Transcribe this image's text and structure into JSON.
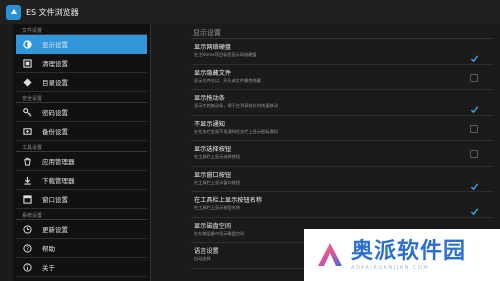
{
  "app": {
    "title": "ES 文件浏览器"
  },
  "sidebar": {
    "sections": [
      {
        "header": "文件设置",
        "items": [
          {
            "label": "显示设置",
            "icon": "display-icon",
            "active": true
          },
          {
            "label": "清理设置",
            "icon": "clean-icon",
            "active": false
          },
          {
            "label": "目录设置",
            "icon": "directory-icon",
            "active": false
          }
        ]
      },
      {
        "header": "安全设置",
        "items": [
          {
            "label": "密码设置",
            "icon": "key-icon",
            "active": false
          },
          {
            "label": "备份设置",
            "icon": "backup-icon",
            "active": false
          }
        ]
      },
      {
        "header": "工具设置",
        "items": [
          {
            "label": "应用管理器",
            "icon": "app-manager-icon",
            "active": false
          },
          {
            "label": "下载管理器",
            "icon": "download-icon",
            "active": false
          },
          {
            "label": "窗口设置",
            "icon": "window-icon",
            "active": false
          }
        ]
      },
      {
        "header": "系统设置",
        "items": [
          {
            "label": "更新设置",
            "icon": "update-icon",
            "active": false
          },
          {
            "label": "帮助",
            "icon": "help-icon",
            "active": false
          },
          {
            "label": "关于",
            "icon": "about-icon",
            "active": false
          }
        ]
      }
    ]
  },
  "content": {
    "header": "显示设置",
    "rows": [
      {
        "title": "显示网络硬盘",
        "subtitle": "在主Home项目标签显示网络硬盘",
        "checked": true
      },
      {
        "title": "显示隐藏文件",
        "subtitle": "显示文件名以 . 开头或文件属性隐藏",
        "checked": false
      },
      {
        "title": "显示拖动条",
        "subtitle": "显示大的拖动条，便于在列表较长时快速移动",
        "checked": true
      },
      {
        "title": "不显示通知",
        "subtitle": "在任务栏里面不再通知任务栏上显示图标通知",
        "checked": false
      },
      {
        "title": "显示选择按钮",
        "subtitle": "在工具栏上显示选择按钮",
        "checked": false
      },
      {
        "title": "显示窗口按钮",
        "subtitle": "在工具栏上显示窗口按钮",
        "checked": true
      },
      {
        "title": "在工具栏上显示按钮名称",
        "subtitle": "在工具栏上显示按钮名称",
        "checked": true
      },
      {
        "title": "显示磁盘空间",
        "subtitle": "在存储设备中显示磁盘空间",
        "checked": true
      },
      {
        "title": "语言设置",
        "subtitle": "自动选择",
        "checked": null
      }
    ]
  },
  "watermark": {
    "name": "奥派软件园",
    "url": "AOPAIRUANJIAN.COM"
  },
  "colors": {
    "accent": "#2f97da",
    "background": "#1b1b1b",
    "sidebar": "#111111"
  }
}
